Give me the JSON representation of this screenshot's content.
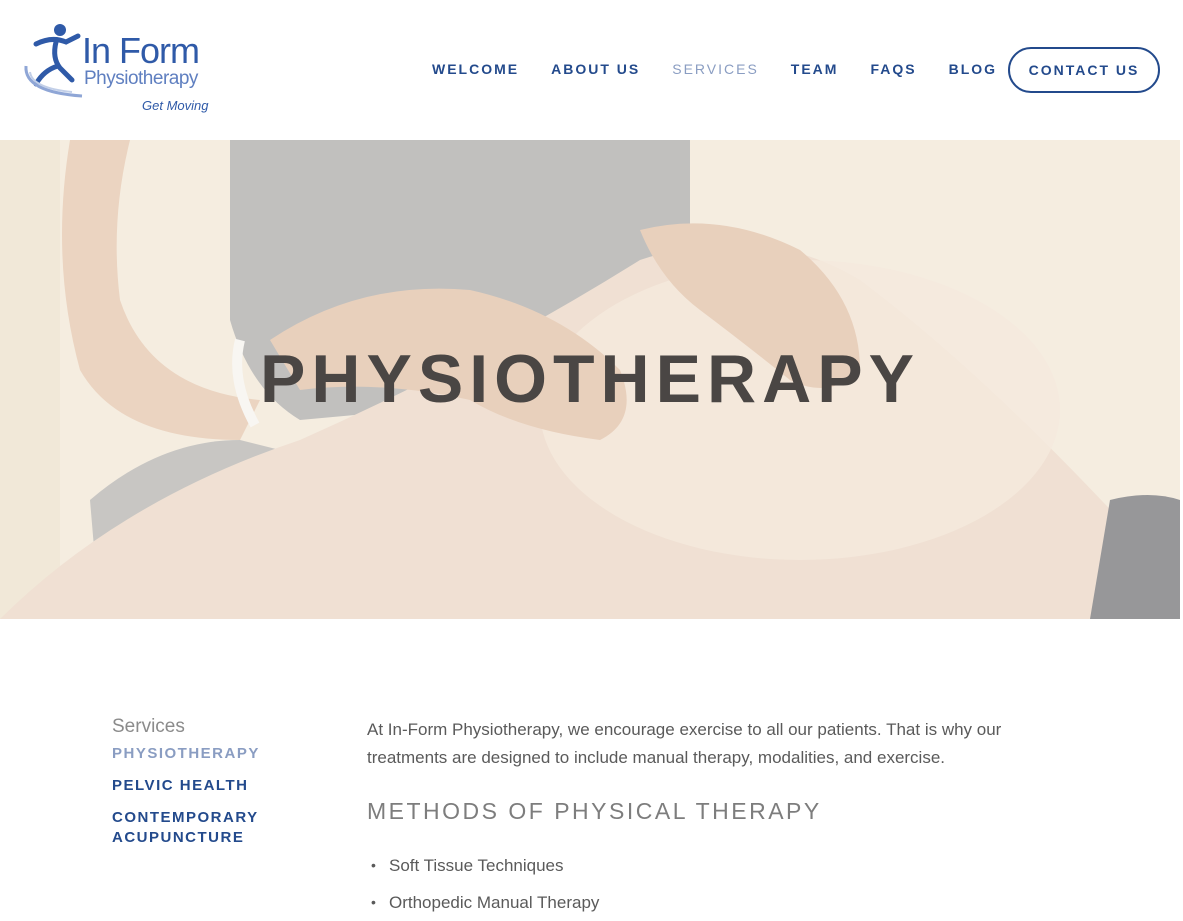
{
  "logo": {
    "title": "In Form",
    "subtitle": "Physiotherapy",
    "tagline": "Get Moving",
    "colors": {
      "primary": "#2f5aa8",
      "light": "#5f7fc0"
    }
  },
  "nav": {
    "items": [
      {
        "label": "WELCOME",
        "active": false
      },
      {
        "label": "ABOUT US",
        "active": false
      },
      {
        "label": "SERVICES",
        "active": true
      },
      {
        "label": "TEAM",
        "active": false
      },
      {
        "label": "FAQS",
        "active": false
      },
      {
        "label": "BLOG",
        "active": false
      }
    ],
    "contact_label": "CONTACT US"
  },
  "hero": {
    "title": "PHYSIOTHERAPY"
  },
  "sidebar": {
    "heading": "Services",
    "items": [
      {
        "label": "PHYSIOTHERAPY",
        "active": true
      },
      {
        "label": "PELVIC HEALTH",
        "active": false
      },
      {
        "label": "CONTEMPORARY ACUPUNCTURE",
        "active": false
      }
    ]
  },
  "content": {
    "intro": "At In-Form Physiotherapy, we encourage exercise to all our patients. That is why our treatments are designed to include manual therapy, modalities, and exercise.",
    "section_title": "METHODS OF PHYSICAL THERAPY",
    "methods": [
      "Soft Tissue Techniques",
      "Orthopedic Manual Therapy"
    ]
  },
  "colors": {
    "brand_blue": "#234a8c",
    "active_nav": "#8a9dc2",
    "body_text": "#5a5a5a"
  }
}
